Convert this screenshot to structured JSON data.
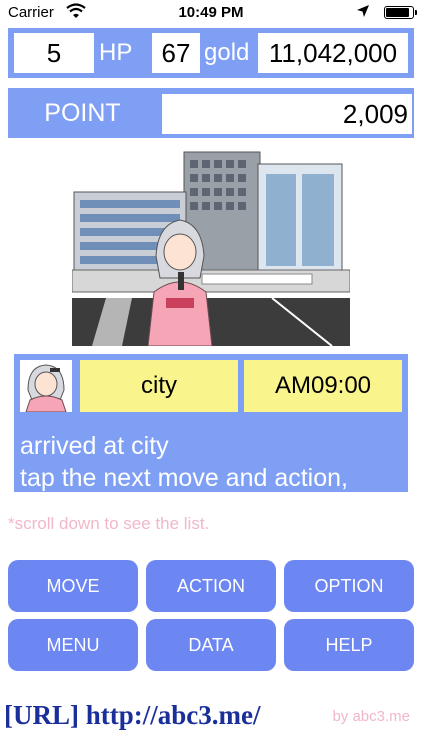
{
  "status_bar": {
    "carrier": "Carrier",
    "time": "10:49 PM",
    "battery_level": 0.9
  },
  "stats": {
    "level": "5",
    "hp_label": "HP",
    "hp": "67",
    "gold_label": "gold",
    "gold": "11,042,000"
  },
  "point": {
    "label": "POINT",
    "value": "2,009"
  },
  "info": {
    "location": "city",
    "time": "AM09:00",
    "message_line1": "arrived at city",
    "message_line2": "tap the next move and action,"
  },
  "hint": "*scroll down to see the list.",
  "buttons": {
    "move": "MOVE",
    "action": "ACTION",
    "option": "OPTION",
    "menu": "MENU",
    "data": "DATA",
    "help": "HELP"
  },
  "footer": {
    "url": "[URL] http://abc3.me/",
    "by": "by abc3.me"
  },
  "colors": {
    "panel": "#7f9ff5",
    "button": "#6c86f2",
    "highlight": "#f9f48c",
    "hint": "#f2b7c8",
    "url": "#1a2f9a"
  },
  "icons": {
    "wifi": "wifi-icon",
    "location": "location-arrow-icon",
    "battery": "battery-icon"
  }
}
